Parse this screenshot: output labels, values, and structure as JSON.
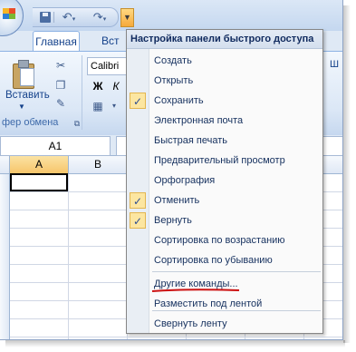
{
  "ribbon": {
    "tab_home": "Главная",
    "tab_insert": "Вст",
    "font_name": "Calibri",
    "paste_label": "Вставить",
    "clipboard_group": "фер обмена",
    "bold": "Ж",
    "italic": "К",
    "right_partial": "Ш"
  },
  "formula_bar": {
    "name_box": "A1"
  },
  "grid": {
    "col_a": "A",
    "col_b": "B"
  },
  "menu": {
    "title": "Настройка панели быстрого доступа",
    "items": [
      {
        "label": "Создать",
        "checked": false
      },
      {
        "label": "Открыть",
        "checked": false
      },
      {
        "label": "Сохранить",
        "checked": true
      },
      {
        "label": "Электронная почта",
        "checked": false
      },
      {
        "label": "Быстрая печать",
        "checked": false
      },
      {
        "label": "Предварительный просмотр",
        "checked": false
      },
      {
        "label": "Орфография",
        "checked": false
      },
      {
        "label": "Отменить",
        "checked": true
      },
      {
        "label": "Вернуть",
        "checked": true
      },
      {
        "label": "Сортировка по возрастанию",
        "checked": false
      },
      {
        "label": "Сортировка по убыванию",
        "checked": false
      },
      {
        "label": "Другие команды...",
        "checked": false
      },
      {
        "label": "Разместить под лентой",
        "checked": false
      },
      {
        "label": "Свернуть ленту",
        "checked": false
      }
    ],
    "check_mark": "✓"
  },
  "colors": {
    "accent": "#15428b",
    "check_bg": "#fce6a1",
    "highlight_red": "#cc1111"
  }
}
